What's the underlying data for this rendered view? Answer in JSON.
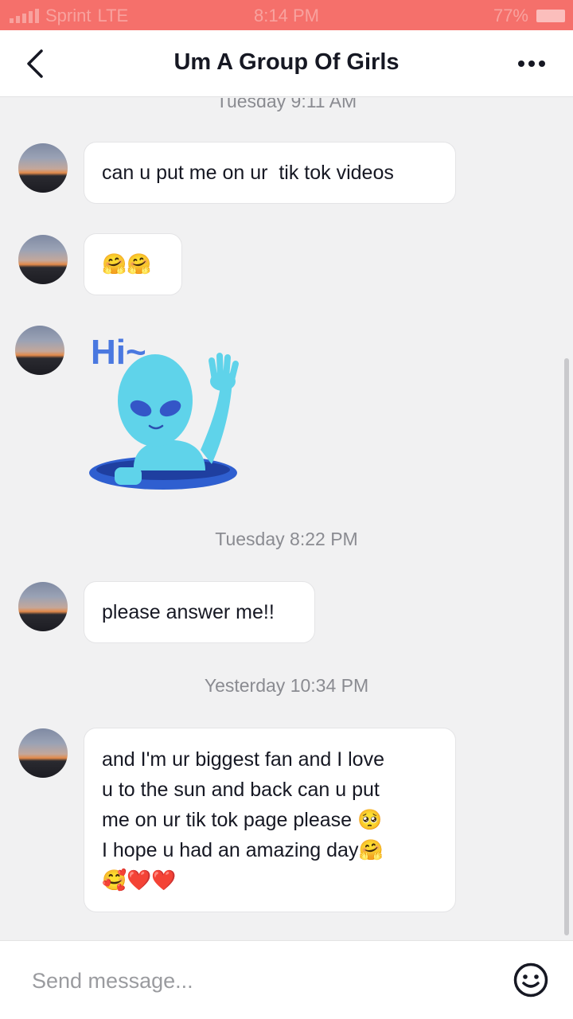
{
  "status_bar": {
    "carrier": "Sprint",
    "network": "LTE",
    "time": "8:14 PM",
    "battery": "77%"
  },
  "header": {
    "title": "Um A Group Of Girls",
    "back_icon": "chevron-left-icon",
    "more_icon": "more-horizontal-icon"
  },
  "messages": {
    "timestamp_top": "Tuesday 9:11 AM",
    "m1": "can u put me on ur  tik tok videos",
    "m2": "🤗🤗",
    "sticker_text": "Hi~",
    "timestamp_2": "Tuesday 8:22 PM",
    "m3": "please answer me!!",
    "timestamp_3": "Yesterday 10:34 PM",
    "m4": "and I'm ur biggest fan and I love\nu to the sun and back can u put\nme on ur tik tok page please 🥺\nI hope u had an amazing day🤗\n🥰❤️❤️"
  },
  "input": {
    "placeholder": "Send message...",
    "value": "",
    "emoji_icon": "smiley-icon"
  },
  "colors": {
    "status_bar": "#f5706b",
    "background": "#f1f1f2",
    "bubble": "#ffffff",
    "sticker": "#5fd3ea"
  }
}
